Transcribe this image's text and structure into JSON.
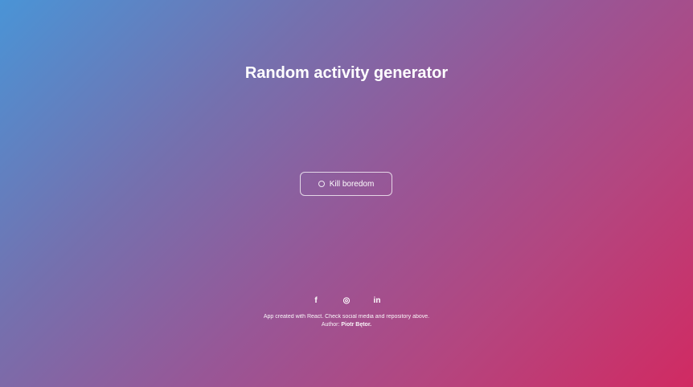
{
  "header": {
    "title": "Random activity generator"
  },
  "main": {
    "button_label": "Kill boredom",
    "button_icon": "clock-icon"
  },
  "footer": {
    "social": [
      {
        "name": "facebook",
        "glyph": "f"
      },
      {
        "name": "github",
        "glyph": "◎"
      },
      {
        "name": "linkedin",
        "glyph": "in"
      }
    ],
    "text": "App created with React. Check social media and repository above.",
    "author_label": "Author:",
    "author_name": "Piotr Bętor."
  }
}
